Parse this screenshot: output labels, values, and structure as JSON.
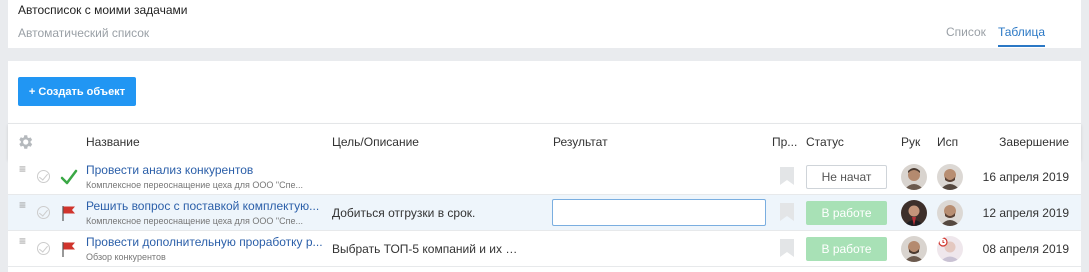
{
  "header": {
    "title": "Автосписок с моими задачами",
    "subtitle": "Автоматический список",
    "views": [
      {
        "label": "Список",
        "active": false
      },
      {
        "label": "Таблица",
        "active": true
      }
    ]
  },
  "toolbar": {
    "create_label": "+ Создать объект"
  },
  "columns": {
    "name": "Название",
    "goal": "Цель/Описание",
    "result": "Результат",
    "priority": "Пр...",
    "status": "Статус",
    "manager": "Рук",
    "executor": "Исп",
    "due": "Завершение"
  },
  "rows": [
    {
      "name": "Провести анализ конкурентов",
      "sub": "Комплексное переоснащение цеха для ООО \"Спе...",
      "goal": "",
      "result": "",
      "status": "Не начат",
      "due": "16 апреля 2019",
      "icon": "checkmark-icon"
    },
    {
      "name": "Решить вопрос с поставкой комплектую...",
      "sub": "Комплексное переоснащение цеха для ООО \"Спе...",
      "goal": "Добиться отгрузки в срок.",
      "result": "",
      "status": "В работе",
      "due": "12 апреля 2019",
      "icon": "flag-icon"
    },
    {
      "name": "Провести дополнительную проработку р...",
      "sub": "Обзор конкурентов",
      "goal": "Выбрать ТОП-5 компаний и их ц...",
      "result": "",
      "status": "В работе",
      "due": "08 апреля 2019",
      "icon": "flag-icon"
    }
  ],
  "colors": {
    "accent": "#2196f3",
    "link": "#2b5fa9",
    "status_in_work": "#a8e1b6",
    "flag": "#d0342c",
    "check": "#3aa845"
  }
}
